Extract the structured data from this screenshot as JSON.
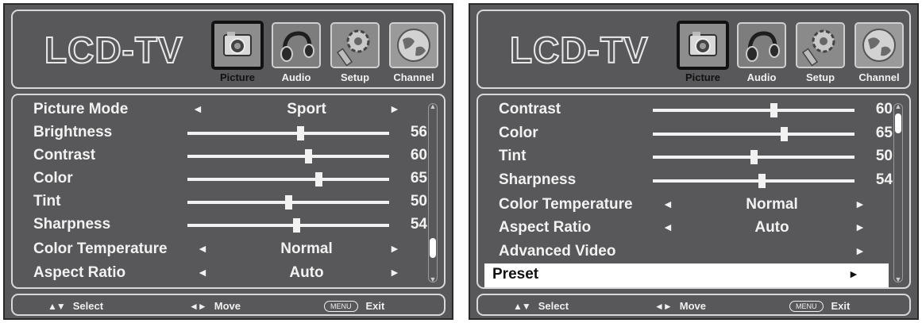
{
  "screens": [
    {
      "logo": "LCD-TV",
      "tabs": [
        {
          "label": "Picture",
          "icon": "camera-icon",
          "selected": true
        },
        {
          "label": "Audio",
          "icon": "headphones-icon",
          "selected": false
        },
        {
          "label": "Setup",
          "icon": "gear-icon",
          "selected": false
        },
        {
          "label": "Channel",
          "icon": "globe-icon",
          "selected": false
        }
      ],
      "rows": [
        {
          "label": "Picture Mode",
          "kind": "option",
          "value": "Sport",
          "left_arrow": "◄",
          "right_arrow": "►"
        },
        {
          "label": "Brightness",
          "kind": "slider",
          "value": 56
        },
        {
          "label": "Contrast",
          "kind": "slider",
          "value": 60
        },
        {
          "label": "Color",
          "kind": "slider",
          "value": 65
        },
        {
          "label": "Tint",
          "kind": "slider",
          "value": 50
        },
        {
          "label": "Sharpness",
          "kind": "slider",
          "value": 54
        },
        {
          "label": "Color Temperature",
          "kind": "option",
          "value": "Normal",
          "left_arrow": "◄",
          "right_arrow": "►"
        },
        {
          "label": "Aspect Ratio",
          "kind": "option",
          "value": "Auto",
          "left_arrow": "◄",
          "right_arrow": "►"
        }
      ],
      "scroll": {
        "position": 0.88,
        "visible_fraction": 0.12
      },
      "footer": {
        "select": "Select",
        "move": "Move",
        "menu_key": "MENU",
        "exit": "Exit"
      }
    },
    {
      "logo": "LCD-TV",
      "tabs": [
        {
          "label": "Picture",
          "icon": "camera-icon",
          "selected": true
        },
        {
          "label": "Audio",
          "icon": "headphones-icon",
          "selected": false
        },
        {
          "label": "Setup",
          "icon": "gear-icon",
          "selected": false
        },
        {
          "label": "Channel",
          "icon": "globe-icon",
          "selected": false
        }
      ],
      "rows": [
        {
          "label": "Contrast",
          "kind": "slider",
          "value": 60
        },
        {
          "label": "Color",
          "kind": "slider",
          "value": 65
        },
        {
          "label": "Tint",
          "kind": "slider",
          "value": 50
        },
        {
          "label": "Sharpness",
          "kind": "slider",
          "value": 54
        },
        {
          "label": "Color Temperature",
          "kind": "option",
          "value": "Normal",
          "left_arrow": "◄",
          "right_arrow": "►"
        },
        {
          "label": "Aspect Ratio",
          "kind": "option",
          "value": "Auto",
          "left_arrow": "◄",
          "right_arrow": "►"
        },
        {
          "label": "Advanced Video",
          "kind": "submenu",
          "right_arrow": "►"
        },
        {
          "label": "Preset",
          "kind": "submenu",
          "right_arrow": "►",
          "selected": true
        }
      ],
      "scroll": {
        "position": 0.02,
        "visible_fraction": 0.12
      },
      "footer": {
        "select": "Select",
        "move": "Move",
        "menu_key": "MENU",
        "exit": "Exit"
      }
    }
  ],
  "colors": {
    "background": "#58585a",
    "text": "#f2f2f2",
    "highlight": "#ffffff"
  },
  "glyphs": {
    "select": "▲▼",
    "move": "◄►"
  }
}
